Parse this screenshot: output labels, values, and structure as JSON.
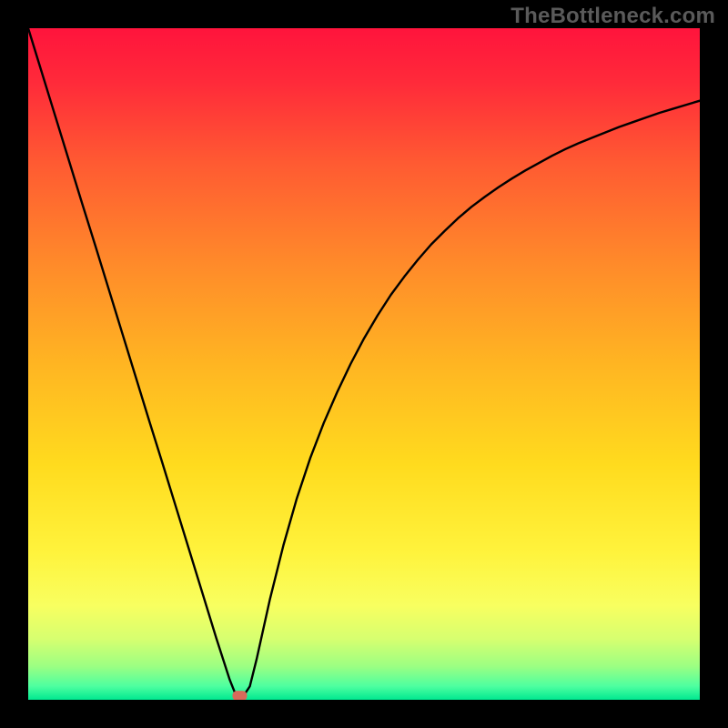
{
  "watermark": "TheBottleneck.com",
  "chart_data": {
    "type": "line",
    "title": "",
    "xlabel": "",
    "ylabel": "",
    "xlim": [
      0,
      100
    ],
    "ylim": [
      0,
      100
    ],
    "grid": false,
    "background": "rainbow-gradient-red-to-green",
    "series": [
      {
        "name": "bottleneck-curve",
        "color": "#000000",
        "x": [
          0,
          2,
          4,
          6,
          8,
          10,
          12,
          14,
          16,
          18,
          20,
          22,
          24,
          26,
          28,
          30,
          31,
          32,
          33,
          34,
          35,
          36,
          38,
          40,
          42,
          44,
          46,
          48,
          50,
          52,
          54,
          56,
          58,
          60,
          62,
          64,
          66,
          68,
          70,
          72,
          74,
          76,
          78,
          80,
          82,
          84,
          86,
          88,
          90,
          92,
          94,
          96,
          98,
          100
        ],
        "y": [
          100,
          93.5,
          87.0,
          80.5,
          74.0,
          67.6,
          61.1,
          54.6,
          48.1,
          41.6,
          35.2,
          28.7,
          22.2,
          15.7,
          9.2,
          3.0,
          0.5,
          0.5,
          2.0,
          6.0,
          10.5,
          15.0,
          23.0,
          30.0,
          36.0,
          41.2,
          45.8,
          50.0,
          53.8,
          57.2,
          60.3,
          63.0,
          65.5,
          67.8,
          69.8,
          71.7,
          73.4,
          74.9,
          76.3,
          77.6,
          78.8,
          79.9,
          81.0,
          82.0,
          82.9,
          83.7,
          84.5,
          85.3,
          86.0,
          86.7,
          87.4,
          88.0,
          88.6,
          89.2
        ]
      }
    ],
    "marker": {
      "name": "ideal-point",
      "x": 31.5,
      "y": 0.6,
      "color": "#d66a5a",
      "shape": "rounded-rect"
    }
  }
}
